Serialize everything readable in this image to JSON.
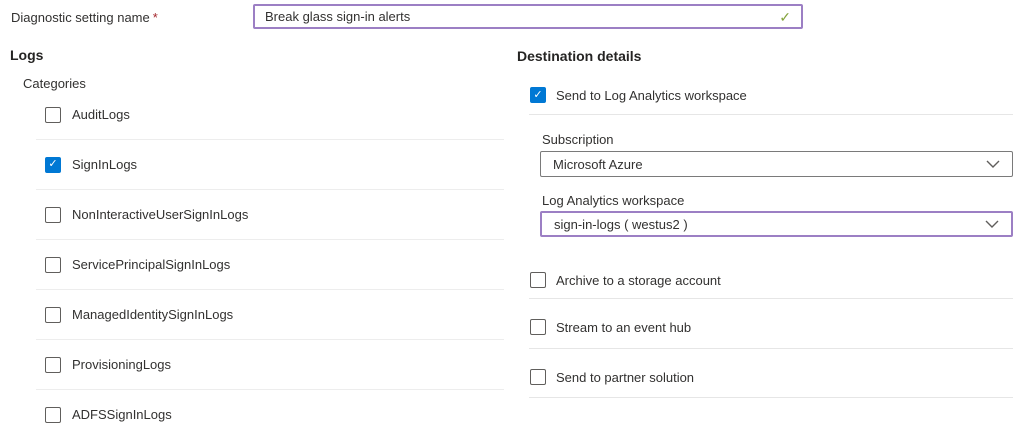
{
  "header": {
    "name_label": "Diagnostic setting name",
    "required_marker": "*",
    "name_value": "Break glass sign-in alerts",
    "valid_icon": "✓"
  },
  "logs": {
    "title": "Logs",
    "subtitle": "Categories",
    "categories": [
      {
        "label": "AuditLogs",
        "checked": false
      },
      {
        "label": "SignInLogs",
        "checked": true
      },
      {
        "label": "NonInteractiveUserSignInLogs",
        "checked": false
      },
      {
        "label": "ServicePrincipalSignInLogs",
        "checked": false
      },
      {
        "label": "ManagedIdentitySignInLogs",
        "checked": false
      },
      {
        "label": "ProvisioningLogs",
        "checked": false
      },
      {
        "label": "ADFSSignInLogs",
        "checked": false
      }
    ]
  },
  "destination": {
    "title": "Destination details",
    "log_analytics_option": {
      "label": "Send to Log Analytics workspace",
      "checked": true
    },
    "subscription": {
      "label": "Subscription",
      "value": "Microsoft Azure"
    },
    "workspace": {
      "label": "Log Analytics workspace",
      "value": "sign-in-logs ( westus2 )"
    },
    "storage_option": {
      "label": "Archive to a storage account",
      "checked": false
    },
    "event_hub_option": {
      "label": "Stream to an event hub",
      "checked": false
    },
    "partner_option": {
      "label": "Send to partner solution",
      "checked": false
    }
  },
  "colors": {
    "accent_blue": "#0078d4",
    "focus_purple": "#9c7fc4",
    "valid_green": "#84a33d",
    "required_red": "#a4262c"
  }
}
